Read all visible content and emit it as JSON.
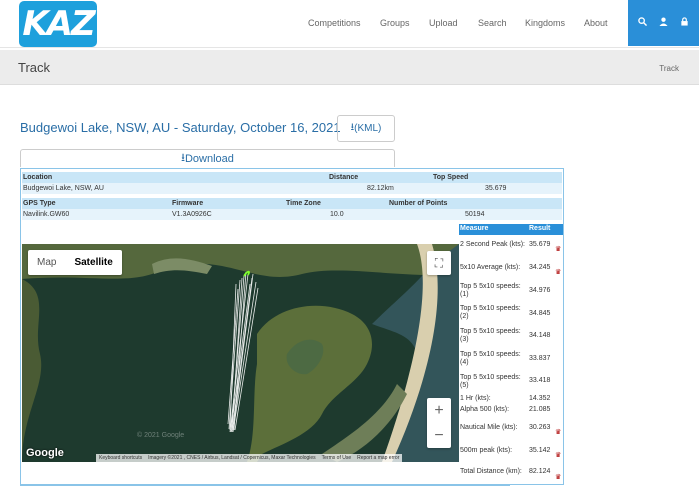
{
  "brand": {
    "logo_text": "KAZ",
    "accent": "#1ea0dc"
  },
  "nav": {
    "items": [
      "Competitions",
      "Groups",
      "Upload",
      "Search",
      "Kingdoms",
      "About"
    ],
    "icons": [
      "search-icon",
      "user-icon",
      "lock-icon"
    ]
  },
  "subheader": {
    "title": "Track",
    "breadcrumb": "Track"
  },
  "track": {
    "title": "Budgewoi Lake, NSW, AU - Saturday, October 16, 2021",
    "kml_label": "(KML)",
    "download_label": "Download"
  },
  "summary": {
    "location_label": "Location",
    "location": "Budgewoi Lake, NSW, AU",
    "distance_label": "Distance",
    "distance": "82.12km",
    "top_speed_label": "Top Speed",
    "top_speed": "35.679",
    "gps_label": "GPS Type",
    "gps": "Navilink.GW60",
    "firmware_label": "Firmware",
    "firmware": "V1.3A0926C",
    "timezone_label": "Time Zone",
    "timezone": "10.0",
    "points_label": "Number of Points",
    "points": "50194"
  },
  "map": {
    "type_map": "Map",
    "type_satellite": "Satellite",
    "selected": "Satellite",
    "zoom_in": "+",
    "zoom_out": "−",
    "google": "Google",
    "shortcuts": "Keyboard shortcuts",
    "imagery": "Imagery ©2021 , CNES / Airbus, Landsat / Copernicus, Maxar Technologies",
    "terms": "Terms of Use",
    "report": "Report a map error",
    "watermark": "© 2021 Google"
  },
  "results": {
    "measure_label": "Measure",
    "result_label": "Result",
    "rows": [
      {
        "label": "2 Second Peak (kts):",
        "value": "35.679",
        "trophy": true
      },
      {
        "label": "5x10 Average (kts):",
        "value": "34.245",
        "trophy": true
      },
      {
        "label": "Top 5 5x10 speeds: (1)",
        "value": "34.976",
        "trophy": false
      },
      {
        "label": "Top 5 5x10 speeds: (2)",
        "value": "34.845",
        "trophy": false
      },
      {
        "label": "Top 5 5x10 speeds: (3)",
        "value": "34.148",
        "trophy": false
      },
      {
        "label": "Top 5 5x10 speeds: (4)",
        "value": "33.837",
        "trophy": false
      },
      {
        "label": "Top 5 5x10 speeds: (5)",
        "value": "33.418",
        "trophy": false
      },
      {
        "label": "1 Hr (kts):",
        "value": "14.352",
        "trophy": false
      },
      {
        "label": "Alpha 500 (kts):",
        "value": "21.085",
        "trophy": false
      },
      {
        "label": "Nautical Mile (kts):",
        "value": "30.263",
        "trophy": true
      },
      {
        "label": "500m peak (kts):",
        "value": "35.142",
        "trophy": true
      },
      {
        "label": "Total Distance (km):",
        "value": "82.124",
        "trophy": true
      }
    ]
  }
}
